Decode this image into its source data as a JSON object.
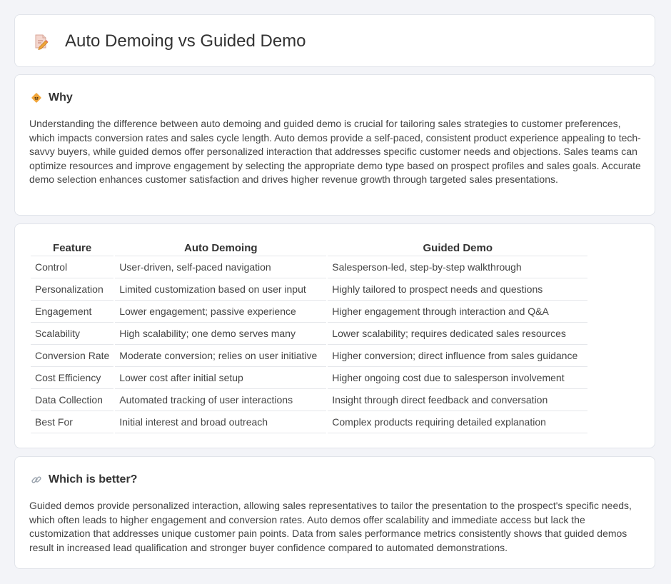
{
  "header": {
    "title": "Auto Demoing vs Guided Demo",
    "icon": "pencil-document-icon"
  },
  "why": {
    "heading": "Why",
    "icon": "bulb-diamond-icon",
    "text": "Understanding the difference between auto demoing and guided demo is crucial for tailoring sales strategies to customer preferences, which impacts conversion rates and sales cycle length. Auto demos provide a self-paced, consistent product experience appealing to tech-savvy buyers, while guided demos offer personalized interaction that addresses specific customer needs and objections. Sales teams can optimize resources and improve engagement by selecting the appropriate demo type based on prospect profiles and sales goals. Accurate demo selection enhances customer satisfaction and drives higher revenue growth through targeted sales presentations."
  },
  "table": {
    "headers": [
      "Feature",
      "Auto Demoing",
      "Guided Demo"
    ],
    "rows": [
      [
        "Control",
        "User-driven, self-paced navigation",
        "Salesperson-led, step-by-step walkthrough"
      ],
      [
        "Personalization",
        "Limited customization based on user input",
        "Highly tailored to prospect needs and questions"
      ],
      [
        "Engagement",
        "Lower engagement; passive experience",
        "Higher engagement through interaction and Q&A"
      ],
      [
        "Scalability",
        "High scalability; one demo serves many",
        "Lower scalability; requires dedicated sales resources"
      ],
      [
        "Conversion Rate",
        "Moderate conversion; relies on user initiative",
        "Higher conversion; direct influence from sales guidance"
      ],
      [
        "Cost Efficiency",
        "Lower cost after initial setup",
        "Higher ongoing cost due to salesperson involvement"
      ],
      [
        "Data Collection",
        "Automated tracking of user interactions",
        "Insight through direct feedback and conversation"
      ],
      [
        "Best For",
        "Initial interest and broad outreach",
        "Complex products requiring detailed explanation"
      ]
    ]
  },
  "better": {
    "heading": "Which is better?",
    "icon": "link-icon",
    "text": "Guided demos provide personalized interaction, allowing sales representatives to tailor the presentation to the prospect's specific needs, which often leads to higher engagement and conversion rates. Auto demos offer scalability and immediate access but lack the customization that addresses unique customer pain points. Data from sales performance metrics consistently shows that guided demos result in increased lead qualification and stronger buyer confidence compared to automated demonstrations."
  },
  "colors": {
    "background": "#f3f4f8",
    "card": "#ffffff",
    "accent_orange": "#f0a53a",
    "icon_pink": "#e88b8b"
  }
}
